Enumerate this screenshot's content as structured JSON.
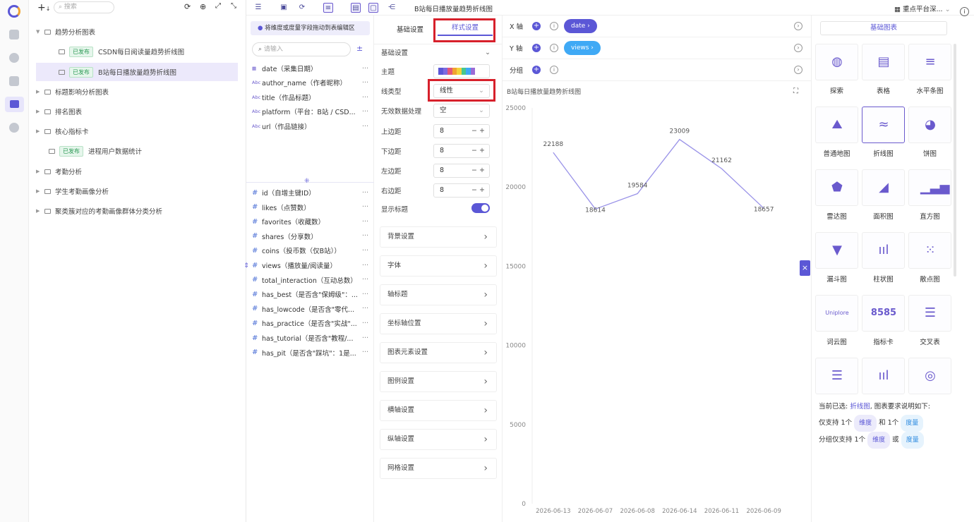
{
  "sidebar_tree": {
    "search_placeholder": "搜索",
    "items": [
      {
        "label": "趋势分析图表",
        "type": "folder",
        "expanded": true
      },
      {
        "label": "CSDN每日阅读量趋势折线图",
        "badge": "已发布",
        "type": "chart"
      },
      {
        "label": "B站每日播放量趋势折线图",
        "badge": "已发布",
        "type": "chart",
        "selected": true
      },
      {
        "label": "标题影响分析图表",
        "type": "folder"
      },
      {
        "label": "排名图表",
        "type": "folder"
      },
      {
        "label": "核心指标卡",
        "type": "folder"
      },
      {
        "label": "进程用户数据统计",
        "badge": "已发布",
        "type": "chart"
      },
      {
        "label": "考勤分析",
        "type": "folder"
      },
      {
        "label": "学生考勤画像分析",
        "type": "folder"
      },
      {
        "label": "聚类簇对应的考勤画像群体分类分析",
        "type": "folder"
      }
    ]
  },
  "topbar": {
    "chart_title": "B站每日播放量趋势折线图",
    "platform": "重点平台深...",
    "platform_icon": "grid-icon"
  },
  "fields_panel": {
    "hint": "将维度或度量字段拖动到表编辑区",
    "search_placeholder": "请输入",
    "dimensions": [
      {
        "icon": "calendar-icon",
        "text": "date（采集日期）"
      },
      {
        "icon": "Abc",
        "text": "author_name（作者昵称）"
      },
      {
        "icon": "Abc",
        "text": "title（作品标题）"
      },
      {
        "icon": "Abc",
        "text": "platform（平台：B站 / CSD..."
      },
      {
        "icon": "Abc",
        "text": "url（作品链接）"
      }
    ],
    "measures": [
      "id（自增主键ID）",
      "likes（点赞数）",
      "favorites（收藏数）",
      "shares（分享数）",
      "coins（投币数（仅B站））",
      "views（播放量/阅读量）",
      "total_interaction（互动总数）",
      "has_best（是否含\"保姆级\"：...",
      "has_lowcode（是否含\"零代...",
      "has_practice（是否含\"实战\"...",
      "has_tutorial（是否含\"教程/...",
      "has_pit（是否含\"踩坑\"：1是..."
    ],
    "more": "···"
  },
  "style_panel": {
    "tab_basic": "基础设置",
    "tab_style": "样式设置",
    "section": "基础设置",
    "rows": {
      "theme": "主题",
      "line_type": "线类型",
      "line_type_value": "线性",
      "invalid": "无效数据处理",
      "invalid_value": "空",
      "top": "上边距",
      "top_value": "8",
      "bottom": "下边距",
      "bottom_value": "8",
      "left": "左边距",
      "left_value": "8",
      "right": "右边距",
      "right_value": "8",
      "show_title": "显示标题"
    },
    "show_title_on": true,
    "collapsibles": [
      "背景设置",
      "字体",
      "轴标题",
      "坐标轴位置",
      "图表元素设置",
      "图例设置",
      "横轴设置",
      "纵轴设置",
      "网格设置"
    ],
    "theme_colors": [
      "#5b57d6",
      "#7d6be0",
      "#e3567a",
      "#f0a330",
      "#f3d33b",
      "#48c78e",
      "#3fa9f5",
      "#9b6bd6"
    ]
  },
  "axes": {
    "x_label": "X 轴",
    "x_field": "date",
    "y_label": "Y 轴",
    "y_field": "views",
    "group_label": "分组"
  },
  "chart_data": {
    "type": "line",
    "title": "B站每日播放量趋势折线图",
    "x": [
      "2026-06-13",
      "2026-06-07",
      "2026-06-08",
      "2026-06-14",
      "2026-06-11",
      "2026-06-09"
    ],
    "values": [
      22188,
      18614,
      19584,
      23009,
      21162,
      18657
    ],
    "ylim": [
      0,
      25000
    ],
    "yticks": [
      0,
      5000,
      10000,
      15000,
      20000,
      25000
    ],
    "line_color": "#9a93e8",
    "grid": false
  },
  "gallery": {
    "tab": "基础图表",
    "items": [
      "探索",
      "表格",
      "水平条图",
      "普通地图",
      "折线图",
      "饼图",
      "雷达图",
      "面积图",
      "直方图",
      "漏斗图",
      "柱状图",
      "散点图",
      "词云图",
      "指标卡",
      "交叉表"
    ],
    "selected": "折线图",
    "metric_sample": "8585",
    "wordcloud_sample": "Uniplore",
    "footer": {
      "current_prefix": "当前已选:",
      "current": "折线图",
      "current_suffix": ", 图表要求说明如下:",
      "line1_a": "仅支持 1个",
      "dim": "维度",
      "line1_b": "和 1个",
      "measure": "度量",
      "line2_a": "分组仅支持 1个",
      "line2_b": "或"
    }
  }
}
